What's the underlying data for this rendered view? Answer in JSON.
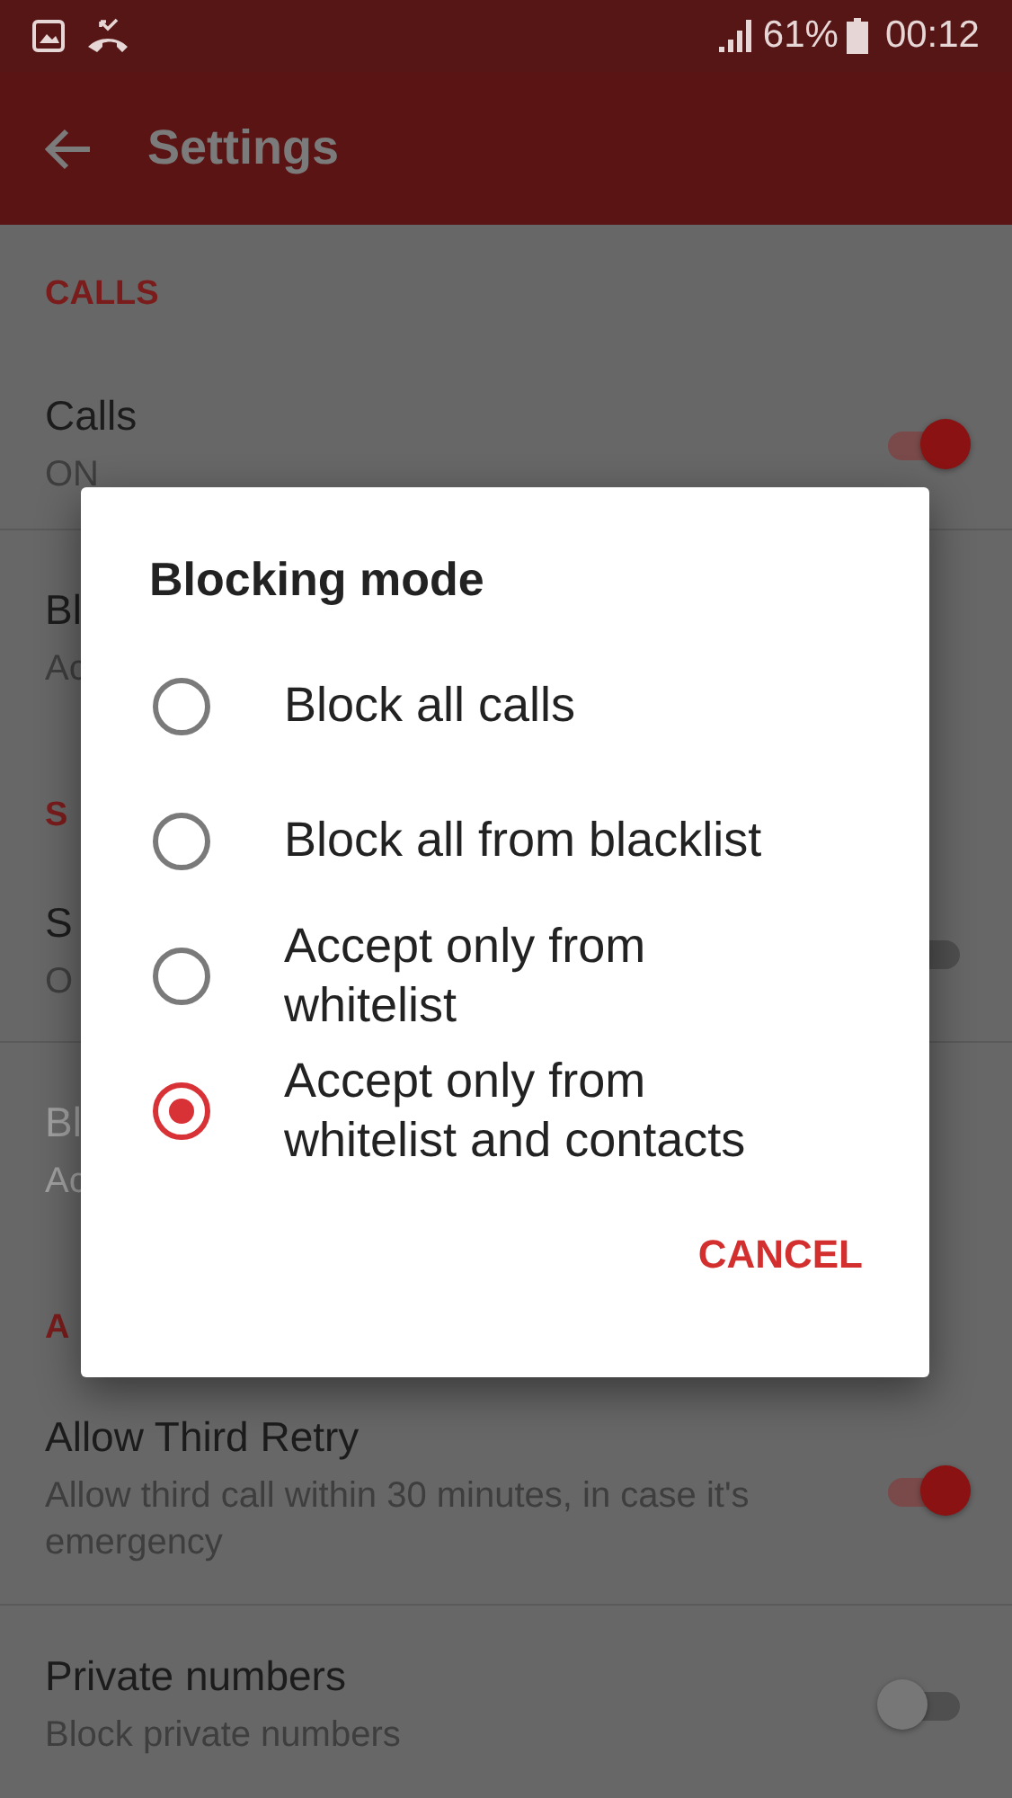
{
  "status_bar": {
    "battery": "61%",
    "time": "00:12"
  },
  "toolbar": {
    "title": "Settings"
  },
  "settings": [
    {
      "kind": "header",
      "label": "CALLS"
    },
    {
      "kind": "toggle",
      "title": "Calls",
      "subtitle": "ON",
      "on": true,
      "disabled": false
    },
    {
      "kind": "item",
      "title": "Bl",
      "subtitle": "Ac",
      "disabled": false
    },
    {
      "kind": "header",
      "label": "S"
    },
    {
      "kind": "toggle",
      "title": "S",
      "subtitle": "O",
      "on": false,
      "disabled": false
    },
    {
      "kind": "item",
      "title": "Bl",
      "subtitle": "Ac",
      "disabled": true
    },
    {
      "kind": "header",
      "label": "A"
    },
    {
      "kind": "toggle",
      "title": "Allow Third Retry",
      "subtitle": "Allow third call within 30 minutes, in case it's emergency",
      "on": true,
      "disabled": false
    },
    {
      "kind": "toggle",
      "title": "Private numbers",
      "subtitle": "Block private numbers",
      "on": false,
      "disabled": false
    }
  ],
  "dialog": {
    "title": "Blocking mode",
    "options": [
      {
        "label": "Block all calls",
        "selected": false
      },
      {
        "label": "Block all from blacklist",
        "selected": false
      },
      {
        "label": "Accept only from whitelist",
        "selected": false
      },
      {
        "label": "Accept only from whitelist and contacts",
        "selected": true
      }
    ],
    "buttons": [
      "CANCEL"
    ]
  }
}
